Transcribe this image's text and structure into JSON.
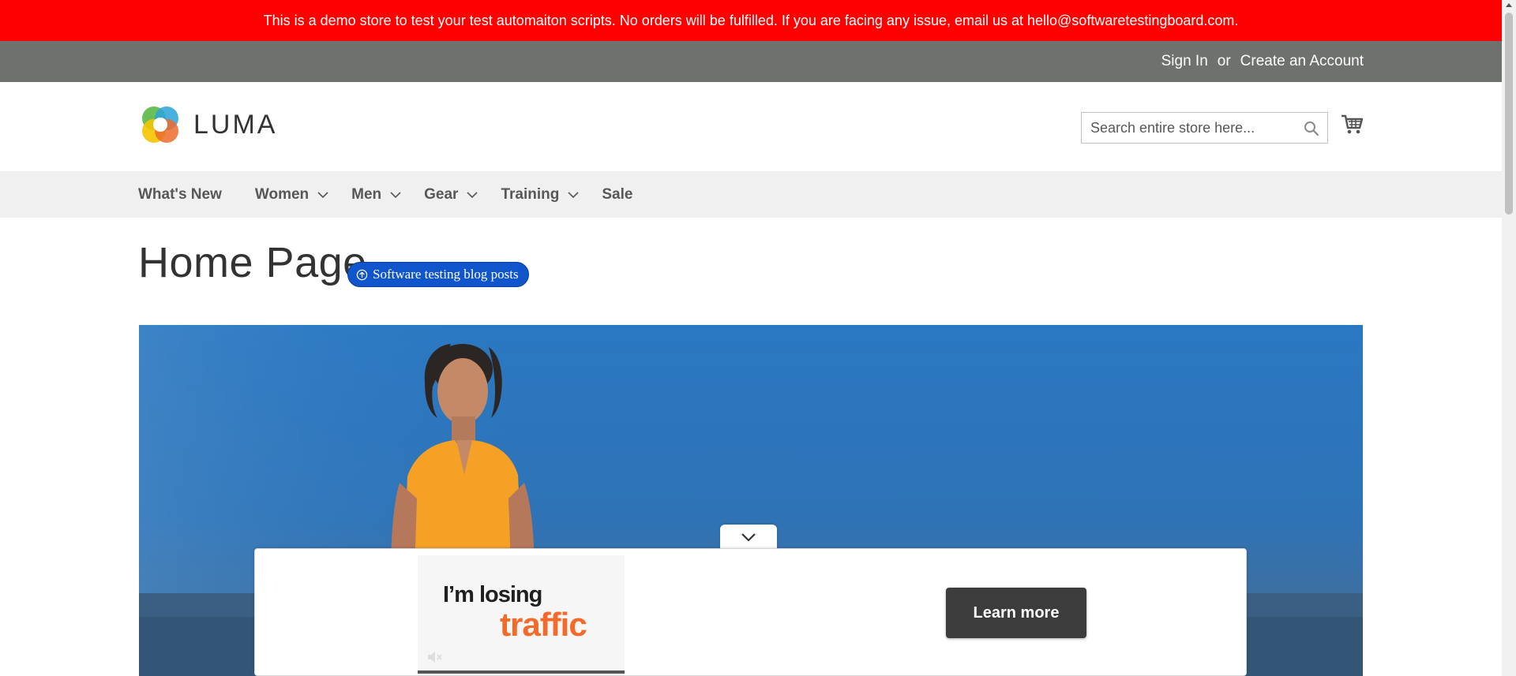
{
  "demo_banner": {
    "text": "This is a demo store to test your test automaiton scripts. No orders will be fulfilled. If you are facing any issue, email us at hello@softwaretestingboard.com."
  },
  "header": {
    "sign_in": "Sign In",
    "or": "or",
    "create_account": "Create an Account"
  },
  "logo": {
    "text": "LUMA"
  },
  "search": {
    "placeholder": "Search entire store here..."
  },
  "nav": {
    "items": [
      {
        "label": "What's New",
        "has_dropdown": false
      },
      {
        "label": "Women",
        "has_dropdown": true
      },
      {
        "label": "Men",
        "has_dropdown": true
      },
      {
        "label": "Gear",
        "has_dropdown": true
      },
      {
        "label": "Training",
        "has_dropdown": true
      },
      {
        "label": "Sale",
        "has_dropdown": false
      }
    ]
  },
  "page": {
    "title": "Home Page",
    "blog_button": "Software testing blog posts"
  },
  "ad": {
    "line1": "I’m losing",
    "line2": "traffic",
    "cta": "Learn more"
  },
  "colors": {
    "banner": "#ff0000",
    "header_bar": "#6e716e",
    "nav_bg": "#f0f0f0",
    "pill": "#1155cc",
    "ad_accent": "#f26b2a",
    "cta_bg": "#3c3c3c"
  }
}
